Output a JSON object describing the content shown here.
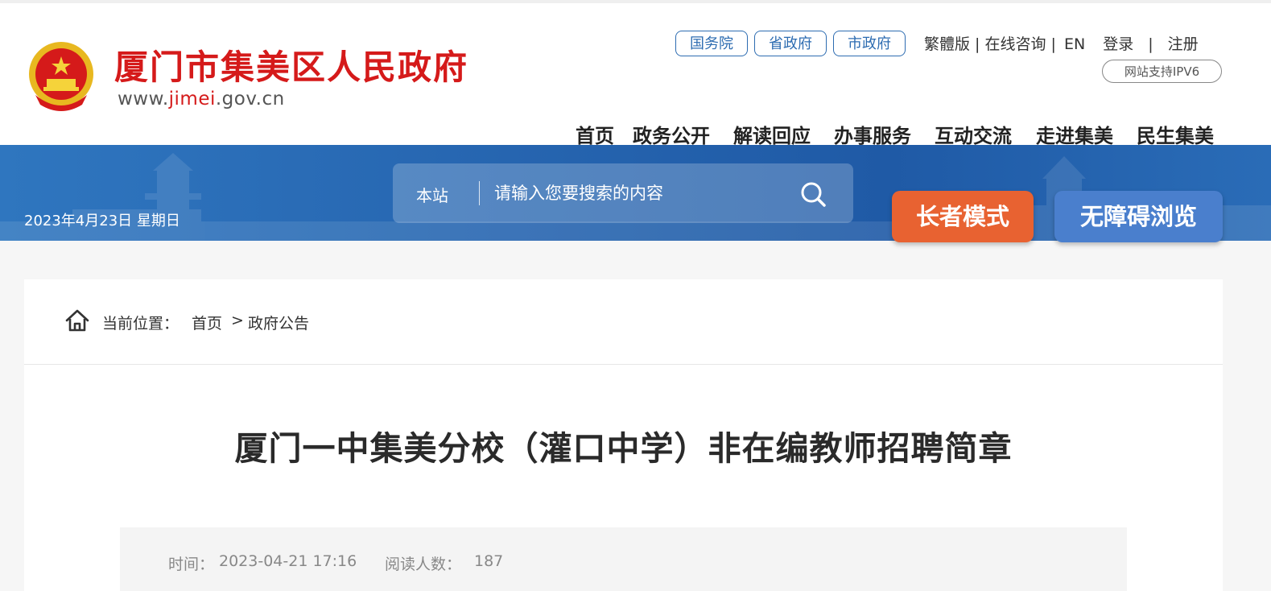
{
  "site": {
    "name": "厦门市集美区人民政府",
    "domain_prefix": "www.",
    "domain_highlight": "jimei",
    "domain_suffix": ".gov.cn"
  },
  "top_pills": [
    "国务院",
    "省政府",
    "市政府"
  ],
  "top_links": {
    "traditional": "繁體版",
    "consult": "在线咨询",
    "english": "EN",
    "login": "登录",
    "register": "注册",
    "ipv6": "网站支持IPV6"
  },
  "nav": [
    "首页",
    "政务公开",
    "解读回应",
    "办事服务",
    "互动交流",
    "走进集美",
    "民生集美"
  ],
  "banner": {
    "date": "2023年4月23日 星期日",
    "search_scope": "本站",
    "search_placeholder": "请输入您要搜索的内容"
  },
  "mode_buttons": {
    "elder": "长者模式",
    "accessible": "无障碍浏览"
  },
  "breadcrumb": {
    "label": "当前位置：",
    "home": "首页",
    "sep": ">",
    "current": "政府公告"
  },
  "article": {
    "title": "厦门一中集美分校（灌口中学）非在编教师招聘简章",
    "time_label": "时间：",
    "time_value": "2023-04-21 17:16",
    "reads_label": "阅读人数：",
    "reads_value": "187"
  },
  "colors": {
    "brand_red": "#d51a1a",
    "brand_blue": "#2665b0",
    "elder_orange": "#e86231",
    "access_blue": "#4a7fcd"
  },
  "icons": [
    "national-emblem-icon",
    "search-icon",
    "home-icon"
  ]
}
